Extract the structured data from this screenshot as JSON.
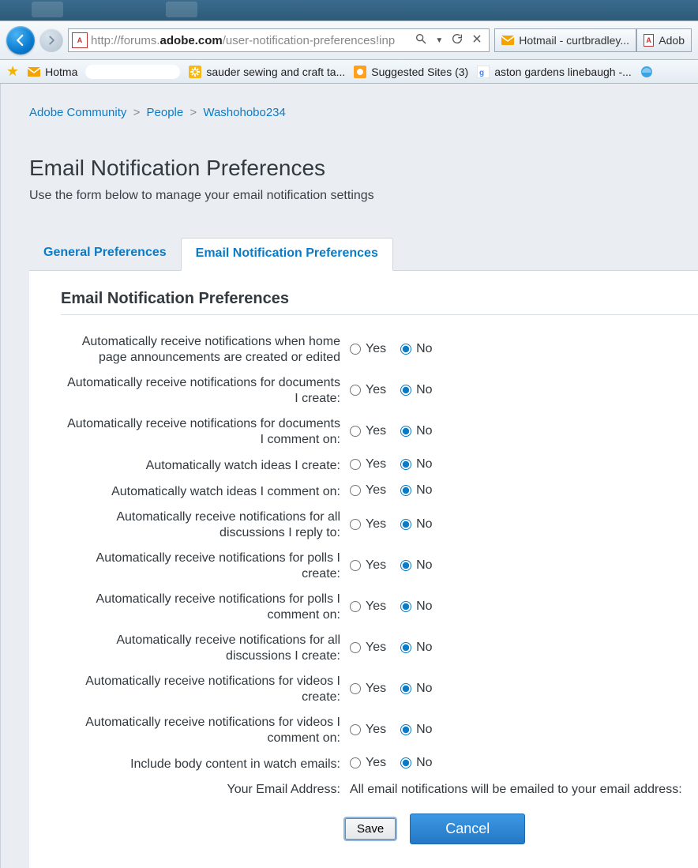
{
  "browser": {
    "url_prefix": "http://forums.",
    "url_domain": "adobe.com",
    "url_rest": "/user-notification-preferences!inp",
    "tabs": [
      {
        "label": "Hotmail - curtbradley..."
      },
      {
        "label": "Adob"
      }
    ],
    "favorites": [
      {
        "label": "Hotma",
        "icon": "mail"
      },
      {
        "label": "sauder sewing and craft ta...",
        "icon": "walmart"
      },
      {
        "label": "Suggested Sites (3)",
        "icon": "yp"
      },
      {
        "label": "aston gardens linebaugh -...",
        "icon": "google"
      }
    ]
  },
  "breadcrumb": {
    "items": [
      "Adobe Community",
      "People",
      "Washohobo234"
    ]
  },
  "page": {
    "title": "Email Notification Preferences",
    "subtitle": "Use the form below to manage your email notification settings"
  },
  "content_tabs": [
    {
      "label": "General Preferences",
      "active": false
    },
    {
      "label": "Email Notification Preferences",
      "active": true
    }
  ],
  "panel_heading": "Email Notification Preferences",
  "option_labels": {
    "yes": "Yes",
    "no": "No"
  },
  "prefs": [
    {
      "label": "Automatically receive notifications when home page announcements are created or edited",
      "value": "no"
    },
    {
      "label": "Automatically receive notifications for documents I create:",
      "value": "no"
    },
    {
      "label": "Automatically receive notifications for documents I comment on:",
      "value": "no"
    },
    {
      "label": "Automatically watch ideas I create:",
      "value": "no"
    },
    {
      "label": "Automatically watch ideas I comment on:",
      "value": "no"
    },
    {
      "label": "Automatically receive notifications for all discussions I reply to:",
      "value": "no"
    },
    {
      "label": "Automatically receive notifications for polls I create:",
      "value": "no"
    },
    {
      "label": "Automatically receive notifications for polls I comment on:",
      "value": "no"
    },
    {
      "label": "Automatically receive notifications for all discussions I create:",
      "value": "no"
    },
    {
      "label": "Automatically receive notifications for videos I create:",
      "value": "no"
    },
    {
      "label": "Automatically receive notifications for videos I comment on:",
      "value": "no"
    },
    {
      "label": "Include body content in watch emails:",
      "value": "no"
    }
  ],
  "email_row": {
    "label": "Your Email Address:",
    "note": "All email notifications will be emailed to your email address:"
  },
  "buttons": {
    "save": "Save",
    "cancel": "Cancel"
  }
}
